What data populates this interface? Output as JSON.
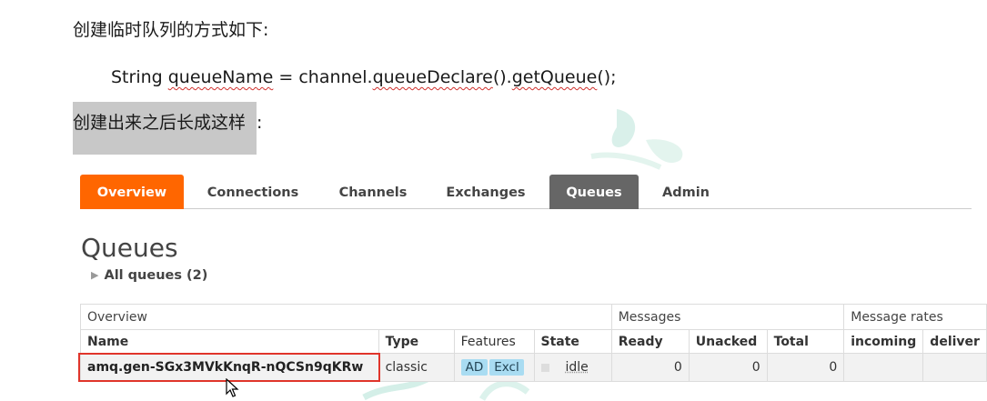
{
  "doc": {
    "line1": "创建临时队列的方式如下:",
    "code_prefix": "String ",
    "code_var": "queueName",
    "code_mid": " = channel.",
    "code_m1": "queueDeclare",
    "code_mid2": "().",
    "code_m2": "getQueue",
    "code_suffix": "();",
    "line2_highlight": "创建出来之后长成这样",
    "line2_colon": ":"
  },
  "nav": {
    "tabs": [
      "Overview",
      "Connections",
      "Channels",
      "Exchanges",
      "Queues",
      "Admin"
    ],
    "active": "Queues"
  },
  "page": {
    "title": "Queues",
    "all_queues": "All queues (2)"
  },
  "table": {
    "groups": [
      "Overview",
      "Messages",
      "Message rates"
    ],
    "headers": [
      "Name",
      "Type",
      "Features",
      "State",
      "Ready",
      "Unacked",
      "Total",
      "incoming",
      "deliver"
    ],
    "row": {
      "name": "amq.gen-SGx3MVkKnqR-nQCSn9qKRw",
      "type": "classic",
      "features": [
        "AD",
        "Excl"
      ],
      "state": "idle",
      "ready": "0",
      "unacked": "0",
      "total": "0"
    }
  },
  "colors": {
    "accent": "#ff6600",
    "active_tab": "#666666",
    "highlight": "#e0352b",
    "badge": "#a9dcf2"
  }
}
